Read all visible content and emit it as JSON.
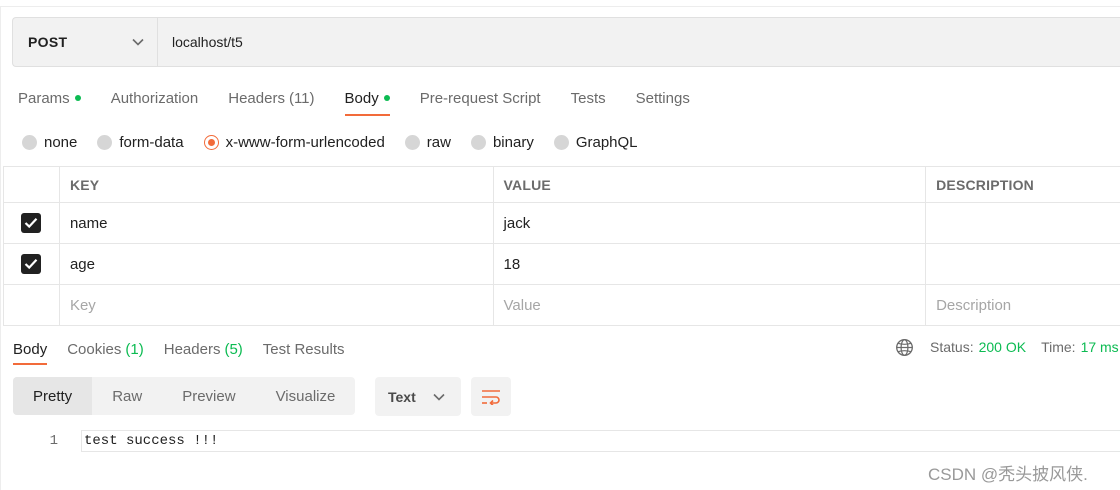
{
  "request": {
    "method": "POST",
    "url": "localhost/t5"
  },
  "request_tabs": [
    {
      "label": "Params",
      "dot": true
    },
    {
      "label": "Authorization"
    },
    {
      "label": "Headers",
      "count": "(11)"
    },
    {
      "label": "Body",
      "dot": true,
      "active": true
    },
    {
      "label": "Pre-request Script"
    },
    {
      "label": "Tests"
    },
    {
      "label": "Settings"
    }
  ],
  "body_types": [
    {
      "label": "none"
    },
    {
      "label": "form-data"
    },
    {
      "label": "x-www-form-urlencoded",
      "selected": true
    },
    {
      "label": "raw"
    },
    {
      "label": "binary"
    },
    {
      "label": "GraphQL"
    }
  ],
  "kv_table": {
    "headers": {
      "key": "KEY",
      "value": "VALUE",
      "description": "DESCRIPTION"
    },
    "rows": [
      {
        "checked": true,
        "key": "name",
        "value": "jack",
        "description": ""
      },
      {
        "checked": true,
        "key": "age",
        "value": "18",
        "description": ""
      }
    ],
    "placeholder": {
      "key": "Key",
      "value": "Value",
      "description": "Description"
    }
  },
  "response_tabs": [
    {
      "label": "Body",
      "active": true
    },
    {
      "label": "Cookies",
      "count": "(1)"
    },
    {
      "label": "Headers",
      "count": "(5)"
    },
    {
      "label": "Test Results"
    }
  ],
  "response_status": {
    "status_label": "Status:",
    "status_value": "200 OK",
    "time_label": "Time:",
    "time_value": "17 ms"
  },
  "view_modes": [
    "Pretty",
    "Raw",
    "Preview",
    "Visualize"
  ],
  "format": "Text",
  "response_body": {
    "line_number": "1",
    "text": "test success !!!"
  },
  "watermark": "CSDN @秃头披风侠.",
  "colors": {
    "accent": "#f26b3a",
    "success": "#0cbb52"
  },
  "icons": [
    "chevron-down-icon",
    "checkmark-icon",
    "globe-icon",
    "wrap-lines-icon"
  ]
}
